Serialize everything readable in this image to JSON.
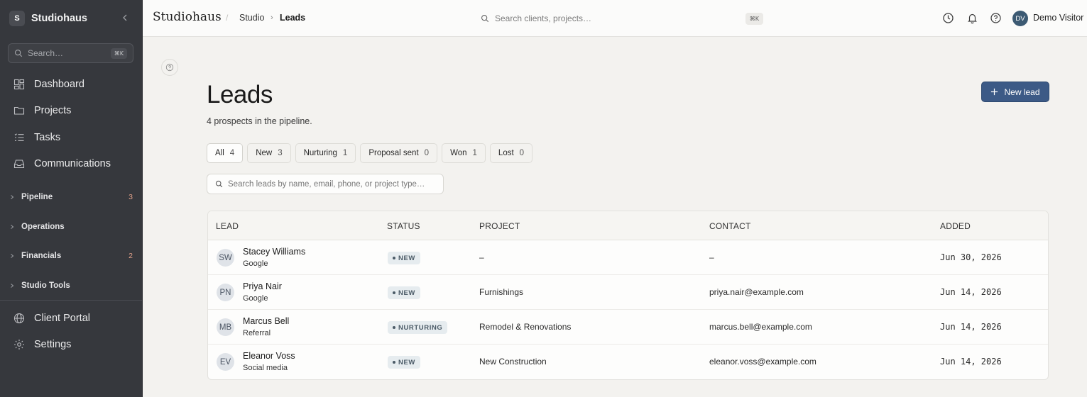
{
  "sidebar": {
    "brand_initial": "S",
    "brand_name": "Studiohaus",
    "search_placeholder": "Search…",
    "search_shortcut": "⌘K",
    "nav": [
      {
        "label": "Dashboard",
        "icon": "dashboard-icon"
      },
      {
        "label": "Projects",
        "icon": "folder-icon"
      },
      {
        "label": "Tasks",
        "icon": "list-icon"
      },
      {
        "label": "Communications",
        "icon": "inbox-icon"
      }
    ],
    "groups": [
      {
        "label": "Pipeline",
        "count": "3"
      },
      {
        "label": "Operations",
        "count": ""
      },
      {
        "label": "Financials",
        "count": "2"
      },
      {
        "label": "Studio Tools",
        "count": ""
      }
    ],
    "bottom": [
      {
        "label": "Client Portal",
        "icon": "globe-icon"
      },
      {
        "label": "Settings",
        "icon": "gear-icon"
      }
    ]
  },
  "topbar": {
    "brand": "Studiohaus",
    "breadcrumb": [
      "Studio",
      "Leads"
    ],
    "search_placeholder": "Search clients, projects…",
    "search_shortcut": "⌘K",
    "user_initials": "DV",
    "user_name": "Demo Visitor"
  },
  "page": {
    "title": "Leads",
    "subtitle": "4 prospects in the pipeline.",
    "new_button": "New lead",
    "filters": [
      {
        "label": "All",
        "count": "4"
      },
      {
        "label": "New",
        "count": "3"
      },
      {
        "label": "Nurturing",
        "count": "1"
      },
      {
        "label": "Proposal sent",
        "count": "0"
      },
      {
        "label": "Won",
        "count": "1"
      },
      {
        "label": "Lost",
        "count": "0"
      }
    ],
    "search_placeholder": "Search leads by name, email, phone, or project type…"
  },
  "table": {
    "columns": [
      "LEAD",
      "STATUS",
      "PROJECT",
      "CONTACT",
      "ADDED"
    ],
    "rows": [
      {
        "initials": "SW",
        "name": "Stacey Williams",
        "source": "Google",
        "status": "NEW",
        "project": "–",
        "contact": "–",
        "added": "Jun 30, 2026"
      },
      {
        "initials": "PN",
        "name": "Priya Nair",
        "source": "Google",
        "status": "NEW",
        "project": "Furnishings",
        "contact": "priya.nair@example.com",
        "added": "Jun 14, 2026"
      },
      {
        "initials": "MB",
        "name": "Marcus Bell",
        "source": "Referral",
        "status": "NURTURING",
        "project": "Remodel & Renovations",
        "contact": "marcus.bell@example.com",
        "added": "Jun 14, 2026"
      },
      {
        "initials": "EV",
        "name": "Eleanor Voss",
        "source": "Social media",
        "status": "NEW",
        "project": "New Construction",
        "contact": "eleanor.voss@example.com",
        "added": "Jun 14, 2026"
      }
    ]
  }
}
